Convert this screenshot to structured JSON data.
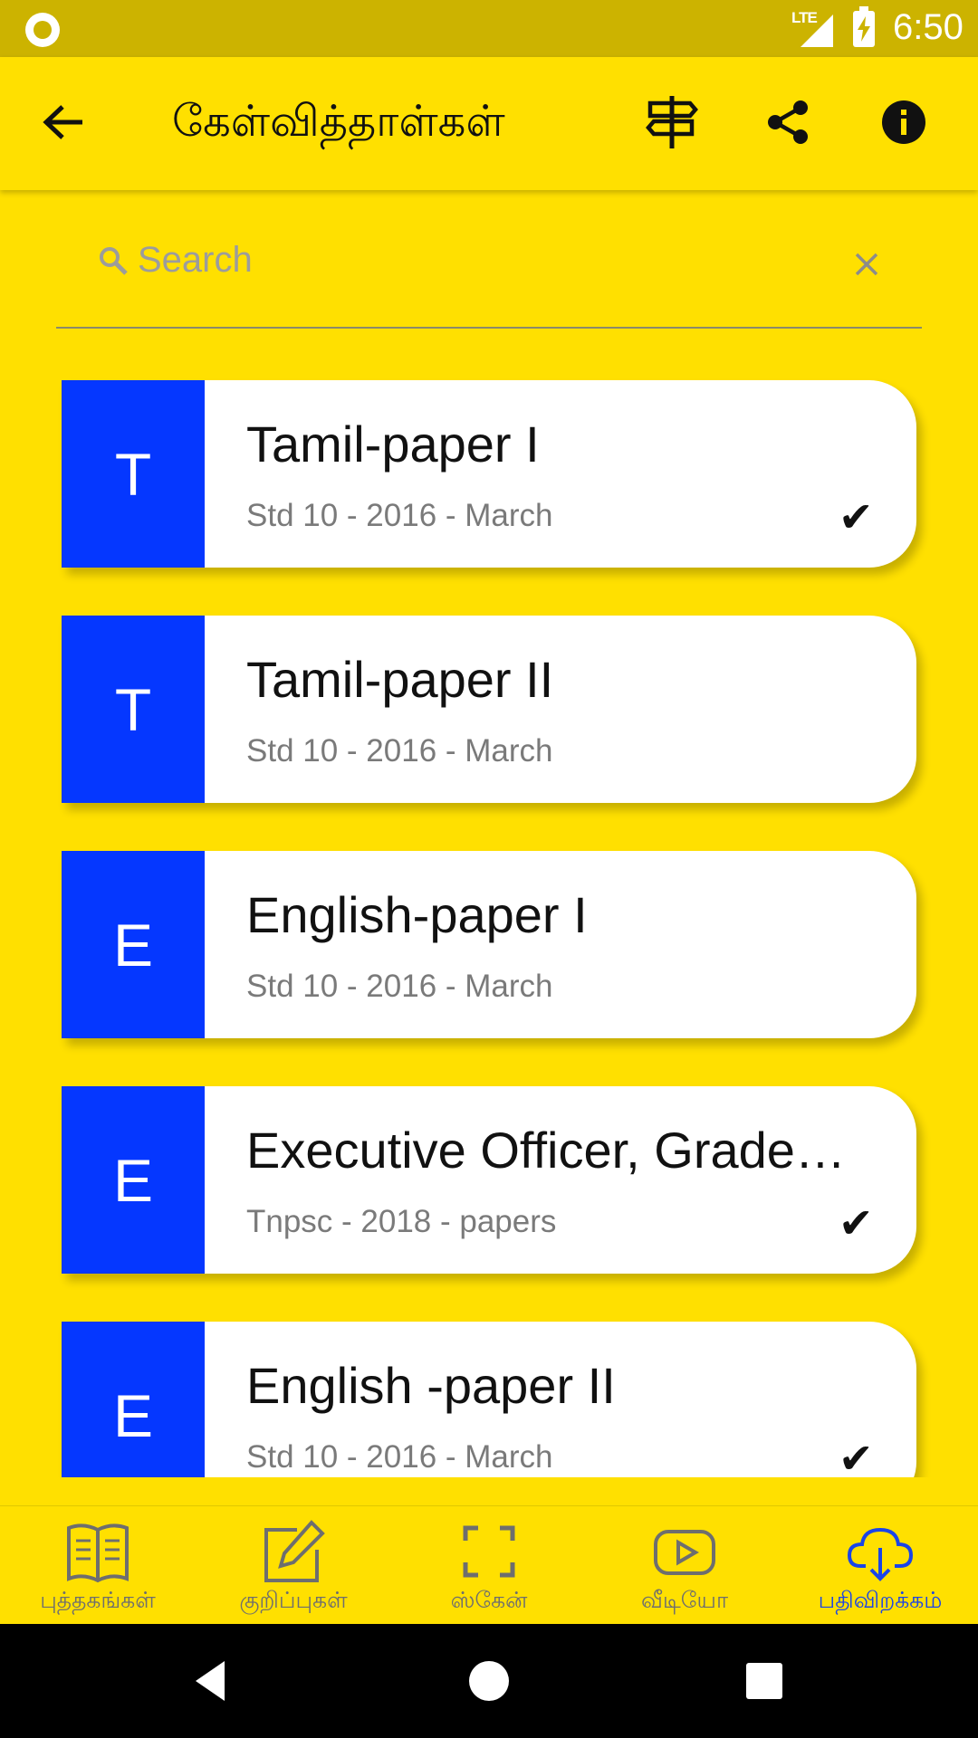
{
  "status_bar": {
    "network": "LTE",
    "time": "6:50"
  },
  "app_bar": {
    "title": "கேள்வித்தாள்கள்",
    "icons": [
      "back-arrow-icon",
      "signpost-icon",
      "share-icon",
      "info-icon"
    ]
  },
  "search": {
    "placeholder": "Search",
    "value": ""
  },
  "papers": [
    {
      "avatar": "T",
      "title": "Tamil-paper I",
      "subtitle": "Std 10 - 2016 - March",
      "check": "✔"
    },
    {
      "avatar": "T",
      "title": "Tamil-paper II",
      "subtitle": "Std 10 - 2016 - March",
      "check": ""
    },
    {
      "avatar": "E",
      "title": "English-paper I",
      "subtitle": "Std 10 - 2016 - March",
      "check": ""
    },
    {
      "avatar": "E",
      "title": "Executive Officer, Grade…",
      "subtitle": "Tnpsc - 2018 - papers",
      "check": "✔"
    },
    {
      "avatar": "E",
      "title": "English -paper II",
      "subtitle": "Std 10 - 2016 - March",
      "check": "✔"
    }
  ],
  "bottom_nav": [
    {
      "label": "புத்தகங்கள்",
      "icon": "book-icon",
      "active": false
    },
    {
      "label": "குறிப்புகள்",
      "icon": "edit-note-icon",
      "active": false
    },
    {
      "label": "ஸ்கேன்",
      "icon": "scan-icon",
      "active": false
    },
    {
      "label": "வீடியோ",
      "icon": "video-play-icon",
      "active": false
    },
    {
      "label": "பதிவிறக்கம்",
      "icon": "cloud-download-icon",
      "active": true
    }
  ],
  "colors": {
    "background": "#FFE000",
    "status_bar": "#CCB300",
    "avatar": "#0537FF",
    "active_nav": "#1a44e8"
  }
}
